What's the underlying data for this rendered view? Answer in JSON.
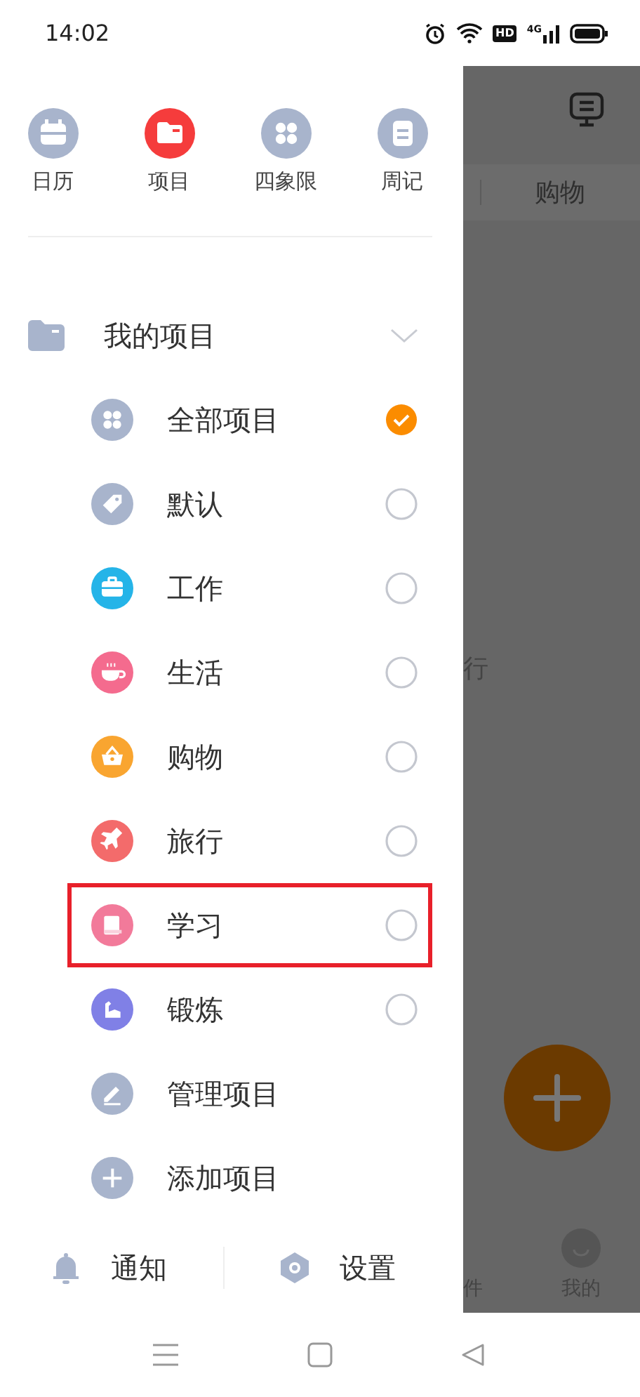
{
  "status_bar": {
    "time": "14:02",
    "badges": [
      "HD",
      "4G"
    ]
  },
  "quick_nav": [
    {
      "label": "日历",
      "selected": false
    },
    {
      "label": "项目",
      "selected": true
    },
    {
      "label": "四象限",
      "selected": false
    },
    {
      "label": "周记",
      "selected": false
    }
  ],
  "section": {
    "title": "我的项目",
    "expanded": true
  },
  "projects": [
    {
      "kind": "project",
      "label": "全部项目",
      "color": "#a8b4cc",
      "checked": true,
      "highlighted": false
    },
    {
      "kind": "project",
      "label": "默认",
      "color": "#a8b4cc",
      "checked": false,
      "highlighted": false
    },
    {
      "kind": "project",
      "label": "工作",
      "color": "#25b4e8",
      "checked": false,
      "highlighted": false
    },
    {
      "kind": "project",
      "label": "生活",
      "color": "#f46b8e",
      "checked": false,
      "highlighted": false
    },
    {
      "kind": "project",
      "label": "购物",
      "color": "#f9a530",
      "checked": false,
      "highlighted": false
    },
    {
      "kind": "project",
      "label": "旅行",
      "color": "#f36b6b",
      "checked": false,
      "highlighted": false
    },
    {
      "kind": "project",
      "label": "学习",
      "color": "#f27a9a",
      "checked": false,
      "highlighted": true
    },
    {
      "kind": "project",
      "label": "锻炼",
      "color": "#8080e6",
      "checked": false,
      "highlighted": false
    },
    {
      "kind": "action",
      "label": "管理项目",
      "color": "#a8b4cc"
    },
    {
      "kind": "action",
      "label": "添加项目",
      "color": "#a8b4cc"
    }
  ],
  "footer": [
    {
      "label": "通知"
    },
    {
      "label": "设置"
    }
  ],
  "background_screen": {
    "tab": "购物",
    "list_text": "行",
    "bottom_tabs": [
      "件",
      "我的"
    ]
  }
}
